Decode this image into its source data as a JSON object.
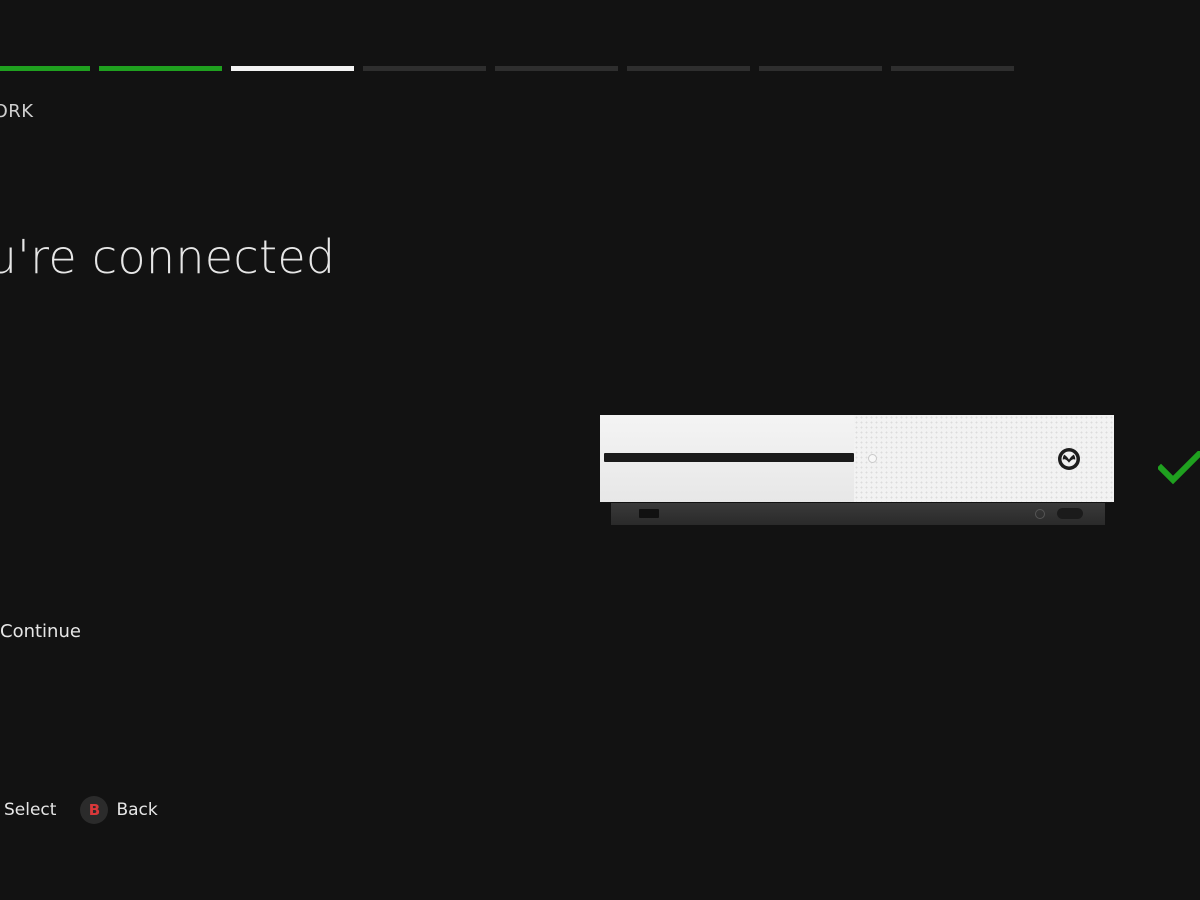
{
  "progress": {
    "total_steps": 8,
    "completed_steps": 2,
    "current_step": 3
  },
  "section_title": "NETWORK",
  "heading": "You're connected",
  "actions": {
    "continue_label": "Continue"
  },
  "footer": {
    "select_label": "Select",
    "back_button_glyph": "B",
    "back_label": "Back"
  },
  "illustration": {
    "device": "console",
    "status_icon": "checkmark-icon",
    "status_color": "#1fa01f"
  },
  "colors": {
    "background": "#121212",
    "accent_green": "#1fa01f",
    "back_button_red": "#d9383a"
  }
}
